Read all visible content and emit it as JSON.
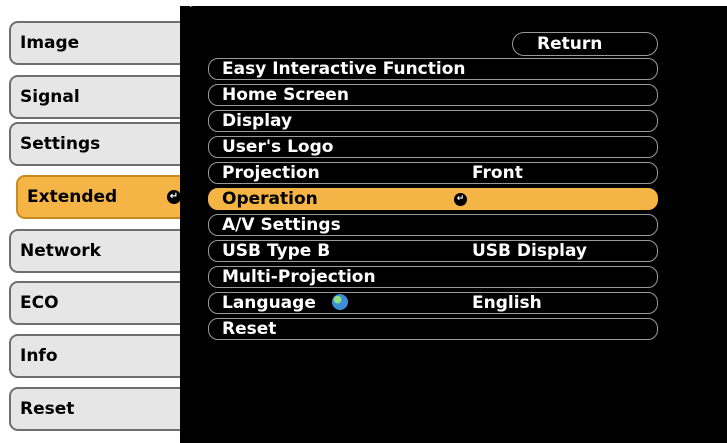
{
  "sidebar": {
    "items": [
      {
        "label": "Image"
      },
      {
        "label": "Signal"
      },
      {
        "label": "Settings"
      },
      {
        "label": "Extended",
        "active": true
      },
      {
        "label": "Network"
      },
      {
        "label": "ECO"
      },
      {
        "label": "Info"
      },
      {
        "label": "Reset"
      }
    ]
  },
  "menu": {
    "return_label": "Return",
    "items": [
      {
        "label": "Easy Interactive Function",
        "value": ""
      },
      {
        "label": "Home Screen",
        "value": ""
      },
      {
        "label": "Display",
        "value": ""
      },
      {
        "label": "User's Logo",
        "value": ""
      },
      {
        "label": "Projection",
        "value": "Front"
      },
      {
        "label": "Operation",
        "value": "",
        "active": true
      },
      {
        "label": "A/V Settings",
        "value": ""
      },
      {
        "label": "USB Type B",
        "value": "USB Display"
      },
      {
        "label": "Multi-Projection",
        "value": ""
      },
      {
        "label": "Language",
        "value": "English",
        "icon": "globe-icon"
      },
      {
        "label": "Reset",
        "value": ""
      }
    ]
  },
  "colors": {
    "accent": "#f4b446",
    "panel": "#000000",
    "tab": "#e6e6e6"
  }
}
